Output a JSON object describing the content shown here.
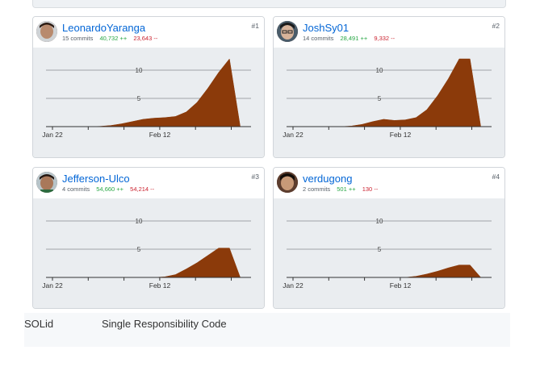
{
  "cards": [
    {
      "rank": "#1",
      "username": "LeonardoYaranga",
      "commits": "15 commits",
      "additions": "40,732 ++",
      "deletions": "23,643 --",
      "avatar": "avatar-1"
    },
    {
      "rank": "#2",
      "username": "JoshSy01",
      "commits": "14 commits",
      "additions": "28,491 ++",
      "deletions": "9,332 --",
      "avatar": "avatar-2"
    },
    {
      "rank": "#3",
      "username": "Jefferson-Ulco",
      "commits": "4 commits",
      "additions": "54,660 ++",
      "deletions": "54,214 --",
      "avatar": "avatar-3"
    },
    {
      "rank": "#4",
      "username": "verdugong",
      "commits": "2 commits",
      "additions": "501 ++",
      "deletions": "130 --",
      "avatar": "avatar-4"
    }
  ],
  "chart_data": [
    {
      "type": "area",
      "x_ticks": [
        "Jan 22",
        "Feb 12"
      ],
      "y_ticks": [
        "10",
        "5"
      ],
      "ylim": [
        0,
        12
      ],
      "x": [
        0,
        1,
        2,
        3,
        4,
        5,
        6,
        7,
        8,
        9,
        10,
        11,
        12,
        13,
        14,
        15,
        16,
        17,
        18,
        19
      ],
      "values": [
        0,
        0,
        0,
        0,
        0,
        0.05,
        0.2,
        0.5,
        0.9,
        1.3,
        1.5,
        1.6,
        1.8,
        2.6,
        4.3,
        6.8,
        9.6,
        12.0,
        0,
        0
      ],
      "color": "#8b3a0a"
    },
    {
      "type": "area",
      "x_ticks": [
        "Jan 22",
        "Feb 12"
      ],
      "y_ticks": [
        "10",
        "5"
      ],
      "ylim": [
        0,
        12
      ],
      "x": [
        0,
        1,
        2,
        3,
        4,
        5,
        6,
        7,
        8,
        9,
        10,
        11,
        12,
        13,
        14,
        15,
        16,
        17,
        18,
        19
      ],
      "values": [
        0,
        0,
        0,
        0,
        0,
        0,
        0.1,
        0.4,
        0.9,
        1.3,
        1.1,
        1.2,
        1.6,
        3.0,
        5.5,
        8.5,
        12.0,
        12.0,
        0,
        0
      ],
      "color": "#8b3a0a"
    },
    {
      "type": "area",
      "x_ticks": [
        "Jan 22",
        "Feb 12"
      ],
      "y_ticks": [
        "10",
        "5"
      ],
      "ylim": [
        0,
        12
      ],
      "x": [
        0,
        1,
        2,
        3,
        4,
        5,
        6,
        7,
        8,
        9,
        10,
        11,
        12,
        13,
        14,
        15,
        16,
        17,
        18,
        19
      ],
      "values": [
        0,
        0,
        0,
        0,
        0,
        0,
        0,
        0,
        0,
        0,
        0,
        0.1,
        0.5,
        1.5,
        2.6,
        3.9,
        5.2,
        5.2,
        0,
        0
      ],
      "color": "#8b3a0a"
    },
    {
      "type": "area",
      "x_ticks": [
        "Jan 22",
        "Feb 12"
      ],
      "y_ticks": [
        "10",
        "5"
      ],
      "ylim": [
        0,
        12
      ],
      "x": [
        0,
        1,
        2,
        3,
        4,
        5,
        6,
        7,
        8,
        9,
        10,
        11,
        12,
        13,
        14,
        15,
        16,
        17,
        18,
        19
      ],
      "values": [
        0,
        0,
        0,
        0,
        0,
        0,
        0,
        0,
        0,
        0,
        0,
        0,
        0.2,
        0.6,
        1.1,
        1.7,
        2.2,
        2.2,
        0,
        0
      ],
      "color": "#8b3a0a"
    }
  ],
  "table": {
    "col1": "SOLid",
    "col2": "Single Responsibility Code"
  }
}
